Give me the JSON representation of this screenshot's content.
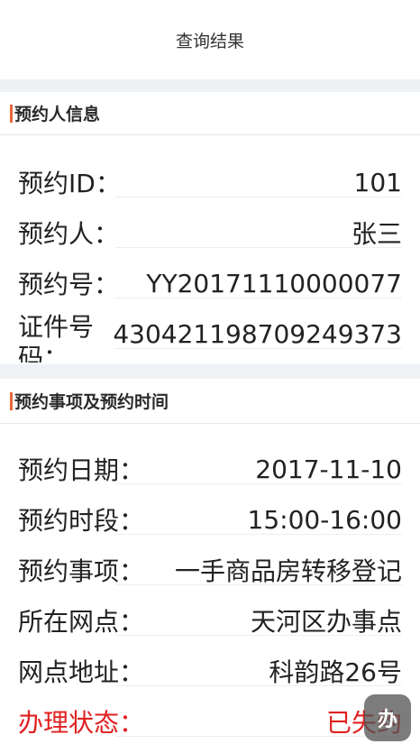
{
  "header": {
    "title": "查询结果"
  },
  "section1": {
    "title": "预约人信息",
    "rows": [
      {
        "label": "预约ID：",
        "value": "101"
      },
      {
        "label": "预约人：",
        "value": "张三"
      },
      {
        "label": "预约号：",
        "value": "YY20171110000077"
      },
      {
        "label": "证件号码：",
        "value": "430421198709249373"
      }
    ]
  },
  "section2": {
    "title": "预约事项及预约时间",
    "rows": [
      {
        "label": "预约日期：",
        "value": "2017-11-10"
      },
      {
        "label": "预约时段：",
        "value": "15:00-16:00"
      },
      {
        "label": "预约事项：",
        "value": "一手商品房转移登记"
      },
      {
        "label": "所在网点：",
        "value": "天河区办事点"
      },
      {
        "label": "网点地址：",
        "value": "科韵路26号"
      },
      {
        "label": "办理状态：",
        "value": "已失约"
      }
    ]
  },
  "float_button": {
    "label": "办"
  },
  "colors": {
    "accent": "#e8663c",
    "status_red": "#e02020",
    "gap_bg": "#eef2f5"
  }
}
